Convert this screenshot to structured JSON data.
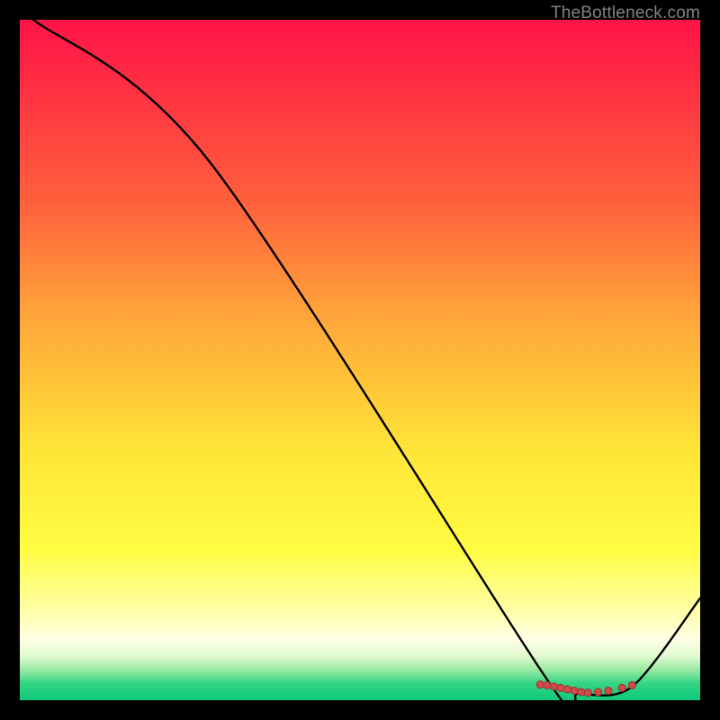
{
  "watermark": "TheBottleneck.com",
  "chart_data": {
    "type": "line",
    "title": "",
    "xlabel": "",
    "ylabel": "",
    "xlim": [
      0,
      100
    ],
    "ylim": [
      0,
      100
    ],
    "grid": false,
    "legend": null,
    "series": [
      {
        "name": "curve",
        "x": [
          2,
          28,
          78,
          82,
          90,
          100
        ],
        "y": [
          100,
          79,
          2.3,
          1.0,
          2.0,
          15
        ]
      }
    ],
    "markers": {
      "name": "bottom-points",
      "x": [
        76.5,
        77.5,
        78.5,
        79.5,
        80.5,
        81.5,
        82.5,
        83.5,
        85.0,
        86.5,
        88.5,
        90.0
      ],
      "y": [
        2.3,
        2.2,
        2.0,
        1.8,
        1.6,
        1.4,
        1.2,
        1.1,
        1.2,
        1.4,
        1.8,
        2.2
      ]
    },
    "gradient_stops": [
      {
        "offset": 0.0,
        "color": "#ff1347"
      },
      {
        "offset": 0.27,
        "color": "#ff613c"
      },
      {
        "offset": 0.43,
        "color": "#ffa33a"
      },
      {
        "offset": 0.63,
        "color": "#ffe437"
      },
      {
        "offset": 0.78,
        "color": "#fffc42"
      },
      {
        "offset": 0.87,
        "color": "#ffffa9"
      },
      {
        "offset": 0.91,
        "color": "#ffffe6"
      },
      {
        "offset": 0.935,
        "color": "#e1fbd0"
      },
      {
        "offset": 0.955,
        "color": "#9ae9a2"
      },
      {
        "offset": 0.975,
        "color": "#34d585"
      },
      {
        "offset": 1.0,
        "color": "#0fc97a"
      }
    ]
  }
}
